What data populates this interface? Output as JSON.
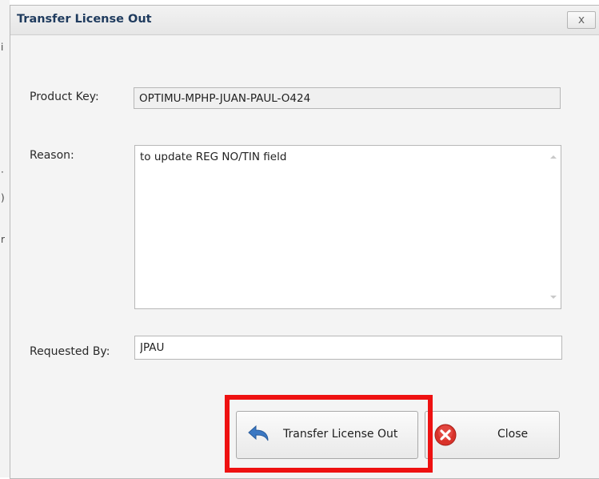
{
  "dialog": {
    "title": "Transfer License Out",
    "close_glyph": "x"
  },
  "form": {
    "product_key": {
      "label": "Product Key:",
      "value": "OPTIMU-MPHP-JUAN-PAUL-O424"
    },
    "reason": {
      "label": "Reason:",
      "value": "to update REG NO/TIN field"
    },
    "requested_by": {
      "label": "Requested By:",
      "value": "JPAU"
    }
  },
  "buttons": {
    "transfer": {
      "label": "Transfer License Out",
      "icon": "undo-arrow-icon"
    },
    "close": {
      "label": "Close",
      "icon": "close-circle-icon"
    }
  },
  "colors": {
    "title_text": "#1f3b5e",
    "highlight": "#ee1111",
    "transfer_icon": "#3b78c3",
    "close_icon": "#d9322a"
  }
}
